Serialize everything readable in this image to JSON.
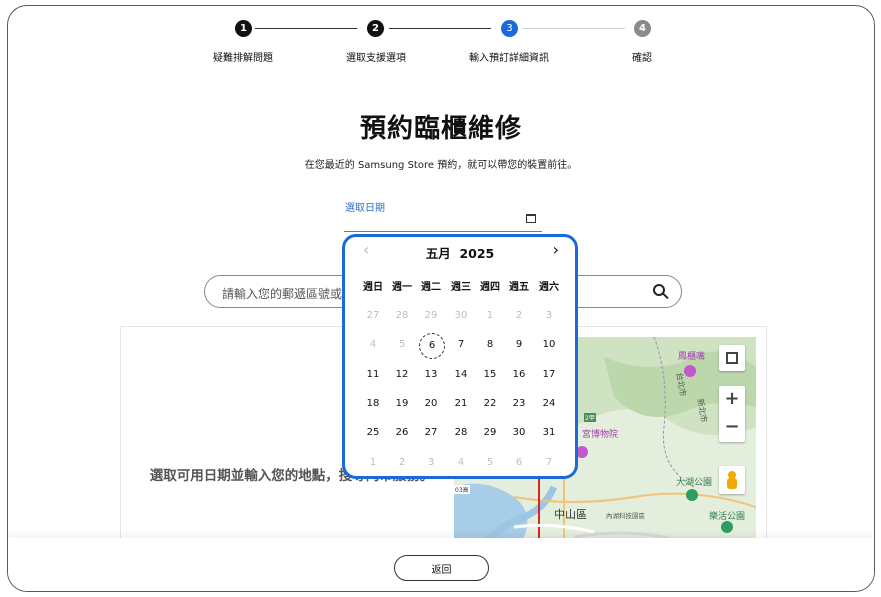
{
  "steps": [
    {
      "num": "1",
      "label": "疑難排解問題",
      "state": "done"
    },
    {
      "num": "2",
      "label": "選取支援選項",
      "state": "done"
    },
    {
      "num": "3",
      "label": "輸入預訂詳細資訊",
      "state": "active"
    },
    {
      "num": "4",
      "label": "確認",
      "state": "pending"
    }
  ],
  "page": {
    "title": "預約臨櫃維修",
    "subtitle": "在您最近的 Samsung Store 預約，就可以帶您的裝置前往。"
  },
  "date_picker": {
    "label": "選取日期",
    "month": "五月",
    "year": "2025",
    "weekdays": [
      "週日",
      "週一",
      "週二",
      "週三",
      "週四",
      "週五",
      "週六"
    ],
    "weeks": [
      [
        "27",
        "28",
        "29",
        "30",
        "1",
        "2",
        "3"
      ],
      [
        "4",
        "5",
        "6",
        "7",
        "8",
        "9",
        "10"
      ],
      [
        "11",
        "12",
        "13",
        "14",
        "15",
        "16",
        "17"
      ],
      [
        "18",
        "19",
        "20",
        "21",
        "22",
        "23",
        "24"
      ],
      [
        "25",
        "26",
        "27",
        "28",
        "29",
        "30",
        "31"
      ],
      [
        "1",
        "2",
        "3",
        "4",
        "5",
        "6",
        "7"
      ]
    ],
    "today": "6"
  },
  "search": {
    "placeholder": "請輸入您的郵遞區號或"
  },
  "result": {
    "message": "選取可用日期並輸入您的地點，搜尋門市服務。"
  },
  "map_labels": {
    "fenguizui": "鳳櫃嘴",
    "taibei": "台北市",
    "xinbei": "新北市",
    "museum": "宮博物院",
    "dahu": "大湖公園",
    "zhongshan": "中山區",
    "neihu": "內湖科技園區",
    "lehe": "樂活公園",
    "road": "2甲",
    "road2": "03高"
  },
  "footer": {
    "back_label": "返回"
  },
  "colors": {
    "accent": "#1a6ad9",
    "done": "#111111",
    "pending": "#8a8a8a"
  }
}
